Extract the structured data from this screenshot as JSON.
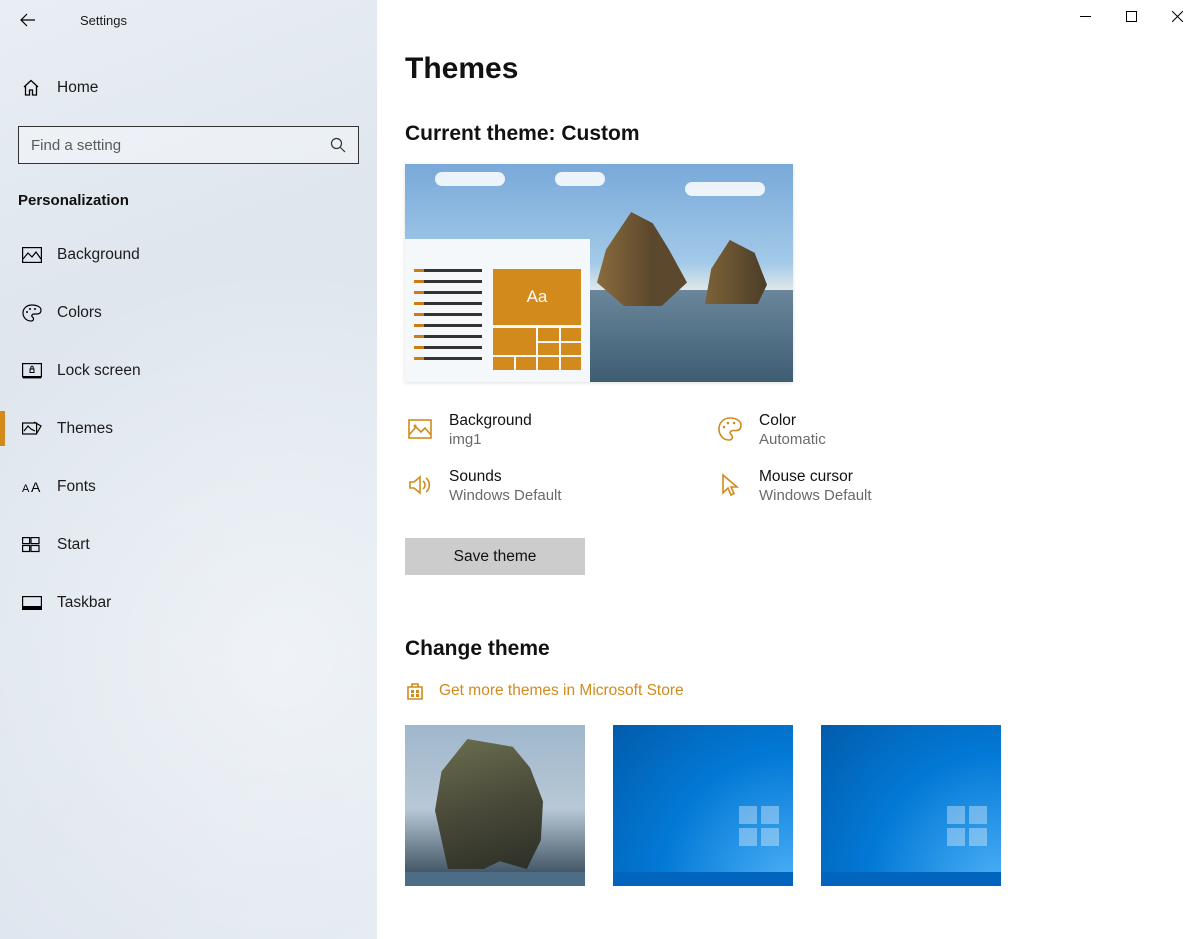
{
  "app_title": "Settings",
  "home_label": "Home",
  "search_placeholder": "Find a setting",
  "section_label": "Personalization",
  "nav": {
    "background": "Background",
    "colors": "Colors",
    "lock_screen": "Lock screen",
    "themes": "Themes",
    "fonts": "Fonts",
    "start": "Start",
    "taskbar": "Taskbar"
  },
  "page": {
    "title": "Themes",
    "current_theme_label": "Current theme: Custom",
    "preview_aa": "Aa",
    "settings": {
      "background": {
        "title": "Background",
        "value": "img1"
      },
      "color": {
        "title": "Color",
        "value": "Automatic"
      },
      "sounds": {
        "title": "Sounds",
        "value": "Windows Default"
      },
      "cursor": {
        "title": "Mouse cursor",
        "value": "Windows Default"
      }
    },
    "save_button": "Save theme",
    "change_theme_label": "Change theme",
    "store_link": "Get more themes in Microsoft Store"
  },
  "accent_color": "#d28a1c"
}
